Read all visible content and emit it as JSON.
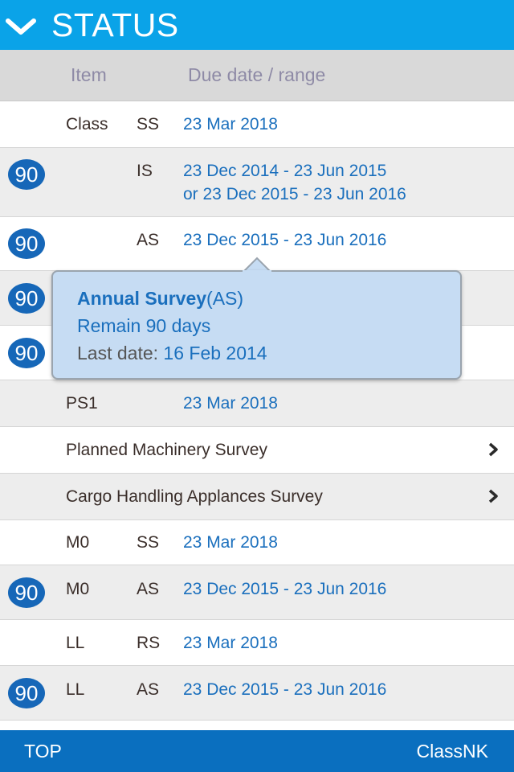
{
  "header": {
    "title": "STATUS",
    "toggle_icon": "chevron-down-icon"
  },
  "columns": {
    "item": "Item",
    "due": "Due date / range"
  },
  "rows": [
    {
      "item": "Class",
      "sub": "SS",
      "date": "23 Mar 2018",
      "badge": ""
    },
    {
      "item": "",
      "sub": "IS",
      "date": "23 Dec 2014 - 23 Jun 2015",
      "date2": "or 23 Dec 2015 - 23 Jun 2016",
      "badge": "90"
    },
    {
      "item": "",
      "sub": "AS",
      "date": "23 Dec 2015 - 23 Jun 2016",
      "badge": "90"
    },
    {
      "badge": "90"
    },
    {
      "badge": "90"
    },
    {
      "item": "PS1",
      "sub": "",
      "date": "23 Mar 2018",
      "badge": ""
    },
    {
      "label": "Planned Machinery Survey"
    },
    {
      "label": "Cargo Handling Applances Survey"
    },
    {
      "item": "M0",
      "sub": "SS",
      "date": "23 Mar 2018",
      "badge": ""
    },
    {
      "item": "M0",
      "sub": "AS",
      "date": "23 Dec 2015 - 23 Jun 2016",
      "badge": "90"
    },
    {
      "item": "LL",
      "sub": "RS",
      "date": "23 Mar 2018",
      "badge": ""
    },
    {
      "item": "LL",
      "sub": "AS",
      "date": "23 Dec 2015 - 23 Jun 2016",
      "badge": "90"
    }
  ],
  "popup": {
    "title": "Annual Survey",
    "title_suffix": "(AS)",
    "remain": "Remain 90 days",
    "last_label": "Last date: ",
    "last_value": "16 Feb 2014"
  },
  "footer": {
    "left": "TOP",
    "right": "ClassNK"
  },
  "colors": {
    "header": "#0aa3e8",
    "footer": "#0a6fbf",
    "badge": "#1667b8",
    "date": "#1a6fbd"
  }
}
